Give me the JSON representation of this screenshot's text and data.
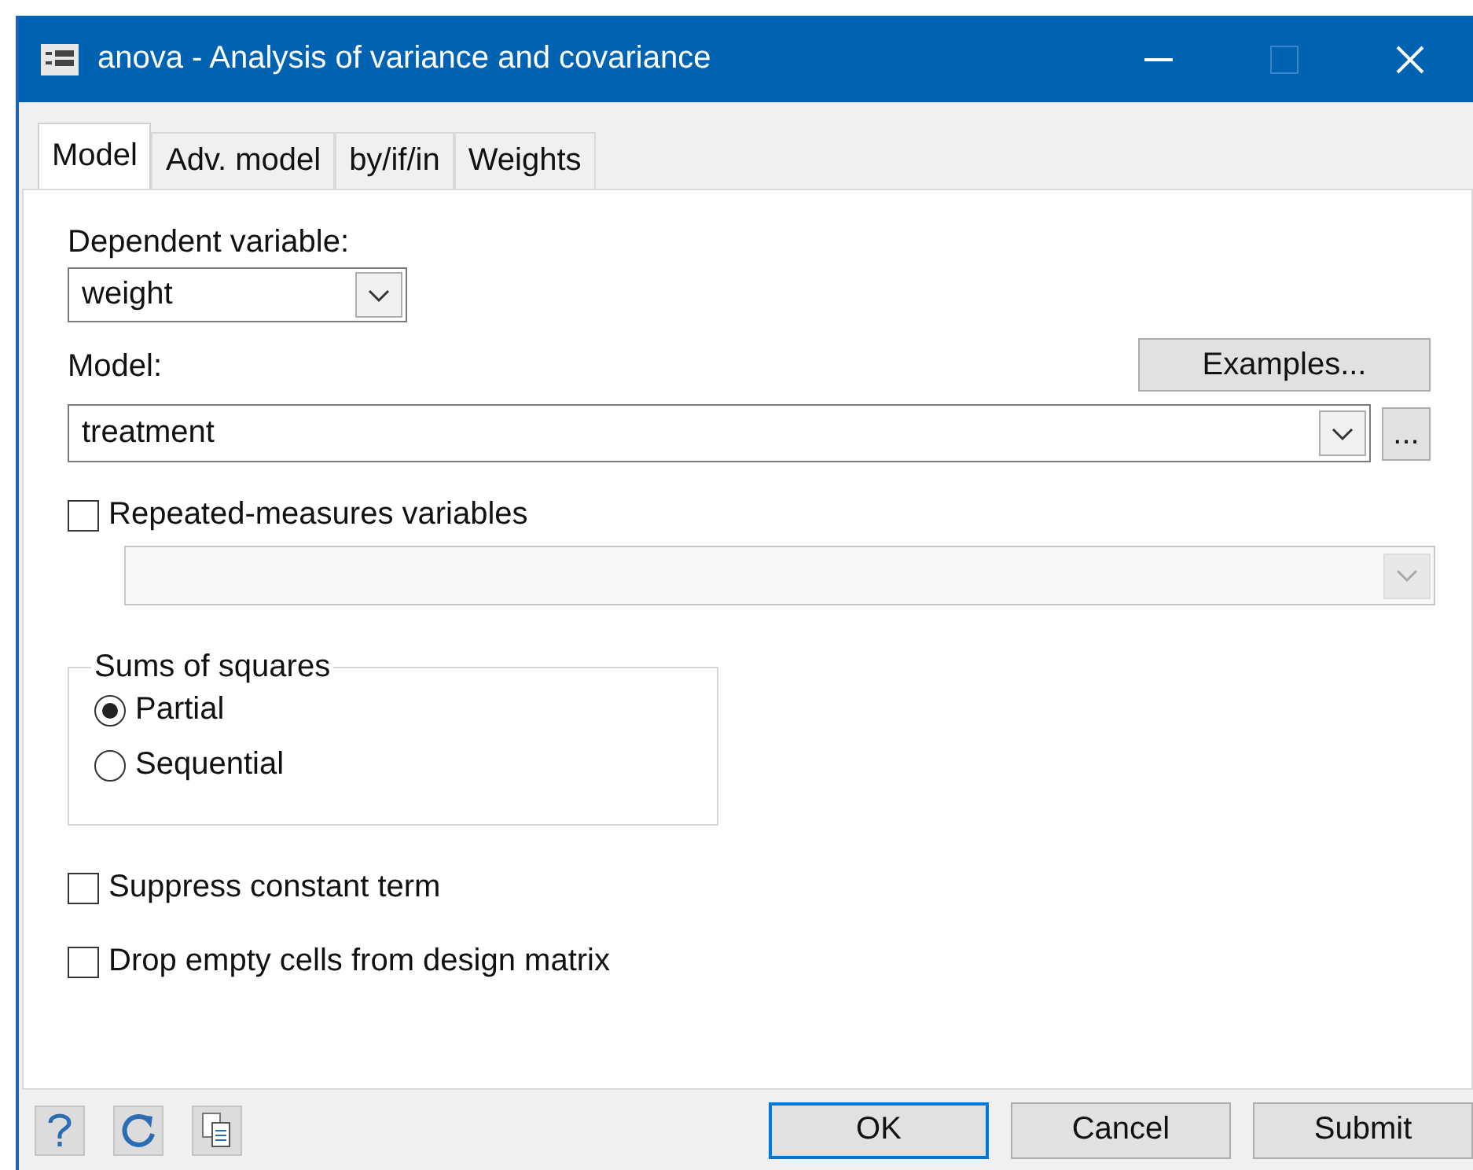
{
  "window": {
    "title": "anova - Analysis of variance and covariance"
  },
  "tabs": [
    {
      "label": "Model",
      "selected": true
    },
    {
      "label": "Adv. model",
      "selected": false
    },
    {
      "label": "by/if/in",
      "selected": false
    },
    {
      "label": "Weights",
      "selected": false
    }
  ],
  "dependent_variable": {
    "label": "Dependent variable:",
    "value": "weight"
  },
  "model": {
    "label": "Model:",
    "value": "treatment",
    "examples_button": "Examples...",
    "browse_button": "..."
  },
  "repeated_measures": {
    "label": "Repeated-measures variables",
    "checked": false,
    "field_disabled": true
  },
  "sums_of_squares": {
    "title": "Sums of squares",
    "options": [
      {
        "label": "Partial",
        "selected": true
      },
      {
        "label": "Sequential",
        "selected": false
      }
    ]
  },
  "options": [
    {
      "label": "Suppress constant term",
      "checked": false
    },
    {
      "label": "Drop empty cells from design matrix",
      "checked": false
    }
  ],
  "footer": {
    "buttons": [
      {
        "label": "OK",
        "default": true
      },
      {
        "label": "Cancel",
        "default": false
      },
      {
        "label": "Submit",
        "default": false
      }
    ]
  }
}
